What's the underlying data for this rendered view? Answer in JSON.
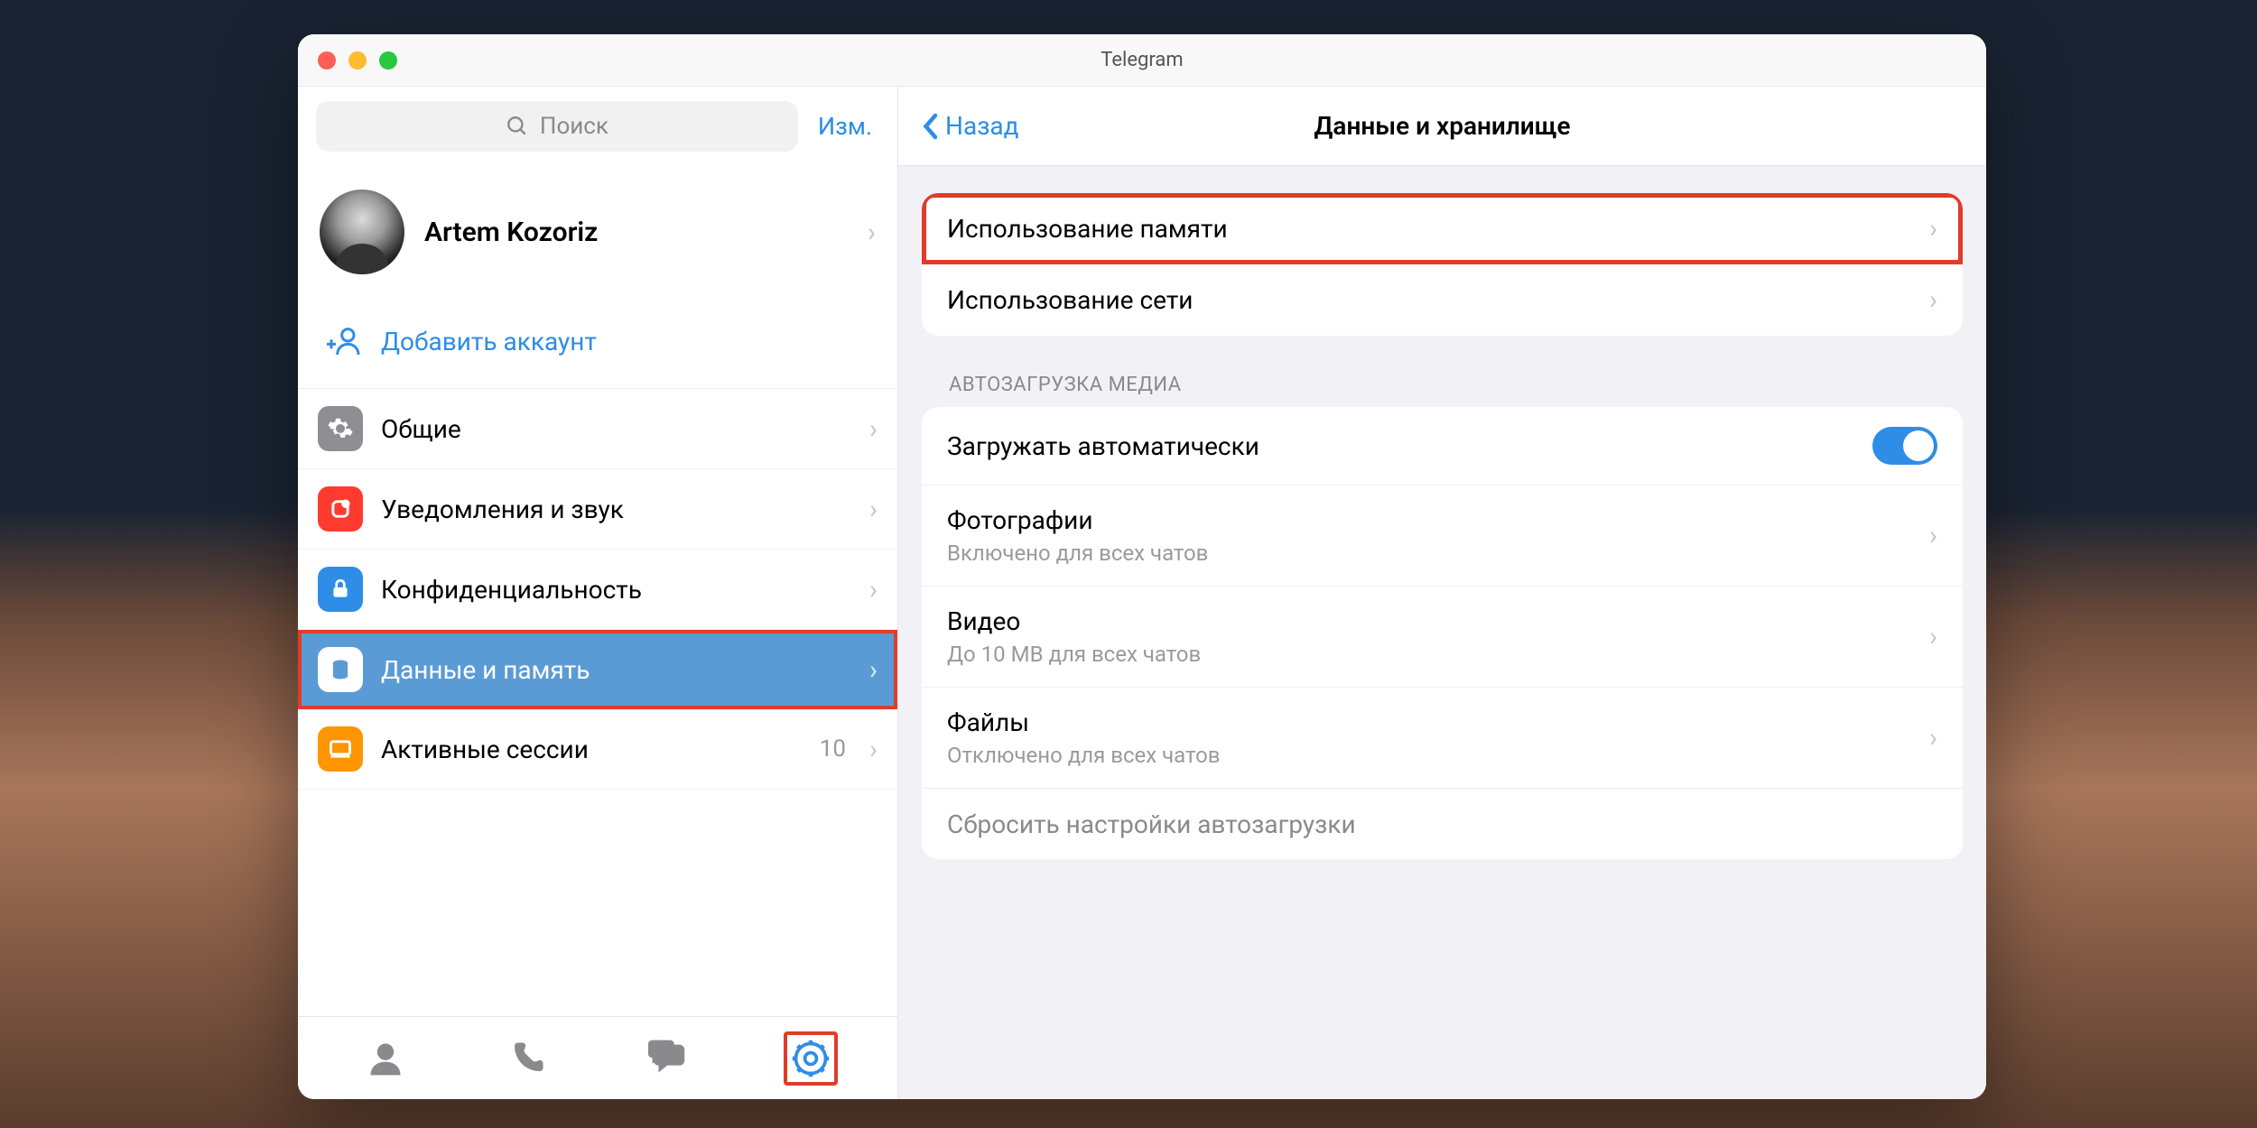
{
  "window": {
    "title": "Telegram"
  },
  "sidebar": {
    "search_placeholder": "Поиск",
    "edit_label": "Изм.",
    "profile_name": "Artem Kozoriz",
    "add_account_label": "Добавить аккаунт",
    "items": [
      {
        "label": "Общие",
        "icon": "gear",
        "color": "#8e8e93"
      },
      {
        "label": "Уведомления и звук",
        "icon": "bell",
        "color": "#ff3b30"
      },
      {
        "label": "Конфиденциальность",
        "icon": "lock",
        "color": "#2e8de6"
      },
      {
        "label": "Данные и память",
        "icon": "database",
        "color": "#5b9bd5",
        "selected": true
      },
      {
        "label": "Активные сессии",
        "icon": "display",
        "color": "#ff9500",
        "badge": "10"
      }
    ]
  },
  "tabs": [
    "contacts",
    "calls",
    "chats",
    "settings"
  ],
  "main": {
    "back_label": "Назад",
    "title": "Данные и хранилище",
    "usage_group": [
      {
        "label": "Использование памяти",
        "highlight": true
      },
      {
        "label": "Использование сети"
      }
    ],
    "autodownload_header": "АВТОЗАГРУЗКА МЕДИА",
    "autodownload_rows": [
      {
        "label": "Загружать автоматически",
        "toggle": true
      },
      {
        "label": "Фотографии",
        "sub": "Включено для всех чатов"
      },
      {
        "label": "Видео",
        "sub": "До 10 MB для всех чатов"
      },
      {
        "label": "Файлы",
        "sub": "Отключено для всех чатов"
      },
      {
        "label": "Сбросить настройки автозагрузки",
        "reset": true
      }
    ]
  }
}
